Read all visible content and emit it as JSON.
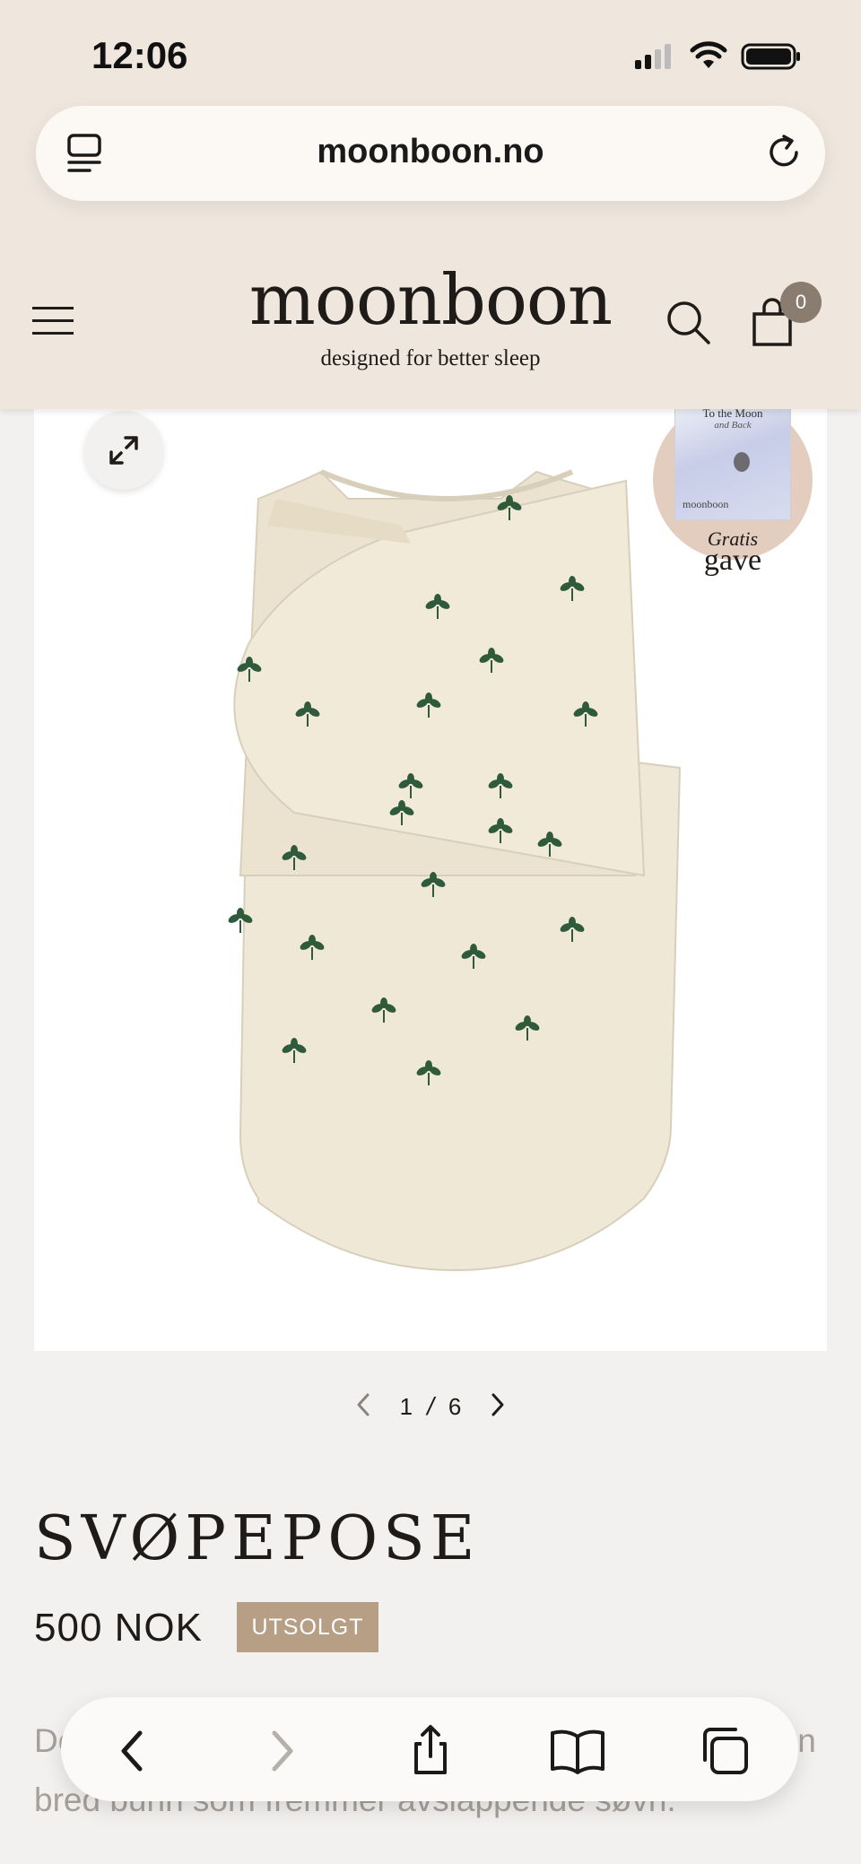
{
  "status_bar": {
    "time": "12:06"
  },
  "browser": {
    "url": "moonboon.no"
  },
  "header": {
    "logo": "moonboon",
    "tagline": "designed for better sleep",
    "cart_count": "0"
  },
  "gallery": {
    "current": "1",
    "separator": "/",
    "total": "6",
    "gift": {
      "book_title": "To the Moon",
      "book_subtitle": "and Back",
      "book_brand": "moonboon",
      "text_line1": "Gratis",
      "text_line2": "gave"
    }
  },
  "product": {
    "title": "SVØPEPOSE",
    "price": "500 NOK",
    "status_badge": "UTSOLGT",
    "description": "De... livmor til verden. Gir en sikker passform med en bred bunn som fremmer avslappende søvn."
  },
  "colors": {
    "header_bg": "#efe7de",
    "badge_bg": "#b79f86",
    "cart_badge_bg": "#8a7c6f",
    "leaf": "#2f5a3c",
    "fabric": "#efe8d7"
  },
  "icons": {
    "tabs": "tabs-icon",
    "reload": "reload-icon",
    "menu": "hamburger-menu-icon",
    "search": "search-icon",
    "cart": "shopping-bag-icon",
    "expand": "expand-icon",
    "back": "chevron-left-icon",
    "forward": "chevron-right-icon",
    "share": "share-icon",
    "bookmarks": "book-icon",
    "tabs_overview": "tabs-overview-icon"
  }
}
